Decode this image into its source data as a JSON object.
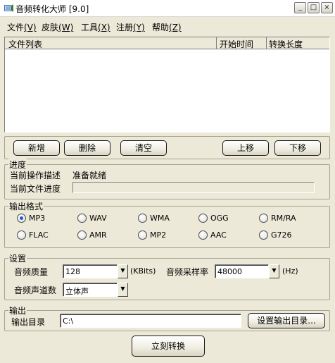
{
  "window": {
    "title": "音频转化大师 [9.0]"
  },
  "window_controls": [
    "_",
    "□",
    "×"
  ],
  "menu": [
    {
      "label": "文件",
      "key": "(V)"
    },
    {
      "label": "皮肤",
      "key": "(W)"
    },
    {
      "label": "工具",
      "key": "(X)"
    },
    {
      "label": "注册",
      "key": "(Y)"
    },
    {
      "label": "帮助",
      "key": "(Z)"
    }
  ],
  "file_list": {
    "columns": [
      "文件列表",
      "开始时间",
      "转换长度"
    ],
    "rows": []
  },
  "list_buttons": [
    "新增",
    "删除",
    "清空",
    "上移",
    "下移"
  ],
  "progress": {
    "title": "进度",
    "op_label": "当前操作描述",
    "op_value": "准备就绪",
    "file_label": "当前文件进度"
  },
  "format": {
    "title": "输出格式",
    "options": [
      "MP3",
      "WAV",
      "WMA",
      "OGG",
      "RM/RA",
      "FLAC",
      "AMR",
      "MP2",
      "AAC",
      "G726"
    ],
    "selected": "MP3"
  },
  "settings": {
    "title": "设置",
    "quality_label": "音频质量",
    "quality_value": "128",
    "quality_unit": "(KBits)",
    "rate_label": "音频采样率",
    "rate_value": "48000",
    "rate_unit": "(Hz)",
    "channel_label": "音频声道数",
    "channel_value": "立体声"
  },
  "output": {
    "title": "输出",
    "dir_label": "输出目录",
    "dir_value": "C:\\",
    "set_dir_button": "设置输出目录..."
  },
  "convert_button": "立刻转换"
}
